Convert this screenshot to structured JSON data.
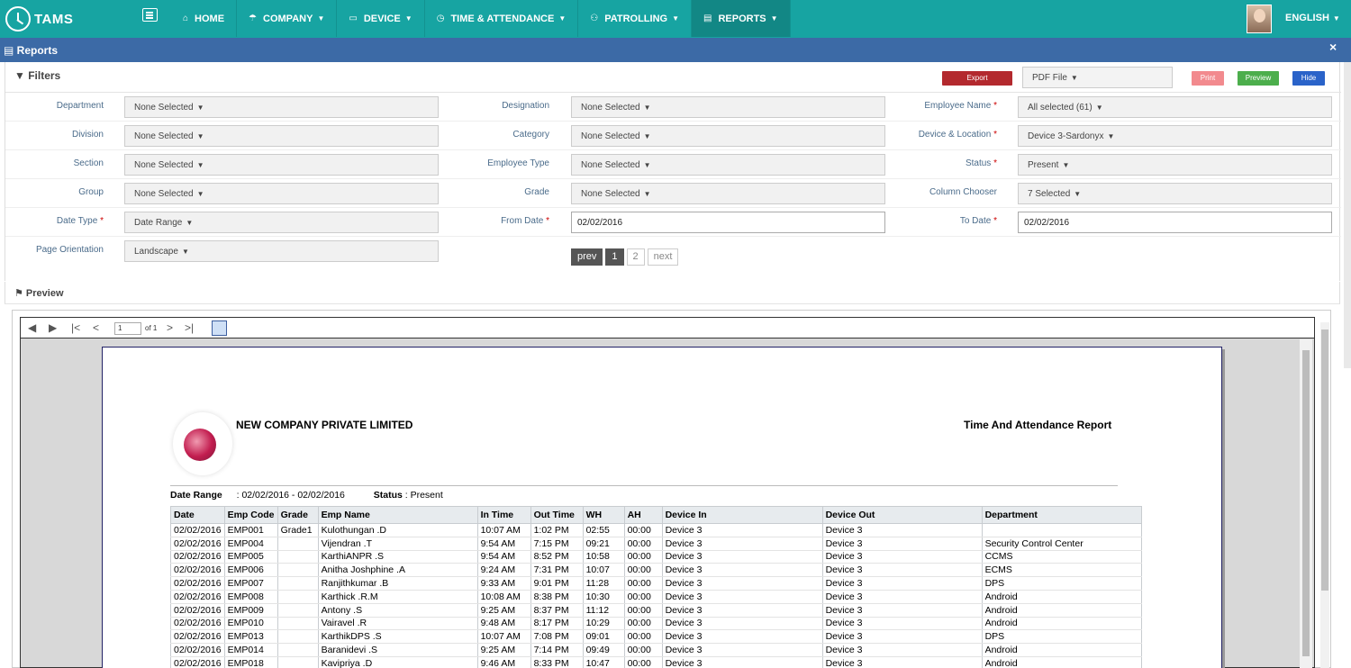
{
  "nav": {
    "brand": "TAMS",
    "items": [
      {
        "label": "HOME",
        "icon": "home-icon",
        "glyph": "⌂",
        "dropdown": false
      },
      {
        "label": "COMPANY",
        "icon": "umbrella-icon",
        "glyph": "☂",
        "dropdown": true
      },
      {
        "label": "DEVICE",
        "icon": "laptop-icon",
        "glyph": "▭",
        "dropdown": true
      },
      {
        "label": "TIME & ATTENDANCE",
        "icon": "clock-icon",
        "glyph": "◷",
        "dropdown": true
      },
      {
        "label": "PATROLLING",
        "icon": "binoculars-icon",
        "glyph": "⚇",
        "dropdown": true
      },
      {
        "label": "REPORTS",
        "icon": "file-icon",
        "glyph": "▤",
        "dropdown": true,
        "active": true
      }
    ],
    "language": "ENGLISH"
  },
  "panel": {
    "title": "Reports",
    "close": "×"
  },
  "filters": {
    "title": "Filters",
    "export_label": "Export",
    "file_format": "PDF File",
    "print_label": "Print",
    "preview_label": "Preview",
    "hide_label": "Hide",
    "department_label": "Department",
    "department_value": "None Selected",
    "division_label": "Division",
    "division_value": "None Selected",
    "section_label": "Section",
    "section_value": "None Selected",
    "group_label": "Group",
    "group_value": "None Selected",
    "date_type_label": "Date Type",
    "date_type_value": "Date Range",
    "page_orientation_label": "Page Orientation",
    "page_orientation_value": "Landscape",
    "designation_label": "Designation",
    "designation_value": "None Selected",
    "category_label": "Category",
    "category_value": "None Selected",
    "employee_type_label": "Employee Type",
    "employee_type_value": "None Selected",
    "grade_label": "Grade",
    "grade_value": "None Selected",
    "from_date_label": "From Date",
    "from_date_value": "02/02/2016",
    "employee_name_label": "Employee Name",
    "employee_name_value": "All selected (61)",
    "device_location_label": "Device & Location",
    "device_location_value": "Device 3-Sardonyx",
    "status_label": "Status",
    "status_value": "Present",
    "column_chooser_label": "Column Chooser",
    "column_chooser_value": "7 Selected",
    "to_date_label": "To Date",
    "to_date_value": "02/02/2016",
    "pager_prev": "prev",
    "pager_page1": "1",
    "pager_page2": "2",
    "pager_next": "next"
  },
  "preview": {
    "title": "Preview",
    "page_input": "1",
    "page_of": "of 1"
  },
  "report": {
    "company": "NEW COMPANY PRIVATE LIMITED",
    "title": "Time And Attendance Report",
    "date_range_label": "Date Range",
    "date_range_value": ": 02/02/2016 - 02/02/2016",
    "status_label": "Status",
    "status_value": ": Present",
    "columns": [
      "Date",
      "Emp Code",
      "Grade",
      "Emp Name",
      "In Time",
      "Out Time",
      "WH",
      "AH",
      "Device In",
      "Device Out",
      "Department"
    ],
    "rows": [
      [
        "02/02/2016",
        "EMP001",
        "Grade1",
        "Kulothungan  .D",
        "10:07 AM",
        "1:02 PM",
        "02:55",
        "00:00",
        "Device 3",
        "Device 3",
        ""
      ],
      [
        "02/02/2016",
        "EMP004",
        "",
        "Vijendran  .T",
        "9:54 AM",
        "7:15 PM",
        "09:21",
        "00:00",
        "Device 3",
        "Device 3",
        "Security Control Center"
      ],
      [
        "02/02/2016",
        "EMP005",
        "",
        "KarthiANPR  .S",
        "9:54 AM",
        "8:52 PM",
        "10:58",
        "00:00",
        "Device 3",
        "Device 3",
        "CCMS"
      ],
      [
        "02/02/2016",
        "EMP006",
        "",
        "Anitha Joshphine  .A",
        "9:24 AM",
        "7:31 PM",
        "10:07",
        "00:00",
        "Device 3",
        "Device 3",
        "ECMS"
      ],
      [
        "02/02/2016",
        "EMP007",
        "",
        "Ranjithkumar  .B",
        "9:33 AM",
        "9:01 PM",
        "11:28",
        "00:00",
        "Device 3",
        "Device 3",
        "DPS"
      ],
      [
        "02/02/2016",
        "EMP008",
        "",
        "Karthick  .R.M",
        "10:08 AM",
        "8:38 PM",
        "10:30",
        "00:00",
        "Device 3",
        "Device 3",
        "Android"
      ],
      [
        "02/02/2016",
        "EMP009",
        "",
        "Antony  .S",
        "9:25 AM",
        "8:37 PM",
        "11:12",
        "00:00",
        "Device 3",
        "Device 3",
        "Android"
      ],
      [
        "02/02/2016",
        "EMP010",
        "",
        "Vairavel  .R",
        "9:48 AM",
        "8:17 PM",
        "10:29",
        "00:00",
        "Device 3",
        "Device 3",
        "Android"
      ],
      [
        "02/02/2016",
        "EMP013",
        "",
        "KarthikDPS  .S",
        "10:07 AM",
        "7:08 PM",
        "09:01",
        "00:00",
        "Device 3",
        "Device 3",
        "DPS"
      ],
      [
        "02/02/2016",
        "EMP014",
        "",
        "Baranidevi  .S",
        "9:25 AM",
        "7:14 PM",
        "09:49",
        "00:00",
        "Device 3",
        "Device 3",
        "Android"
      ],
      [
        "02/02/2016",
        "EMP018",
        "",
        "Kavipriya  .D",
        "9:46 AM",
        "8:33 PM",
        "10:47",
        "00:00",
        "Device 3",
        "Device 3",
        "Android"
      ]
    ]
  }
}
